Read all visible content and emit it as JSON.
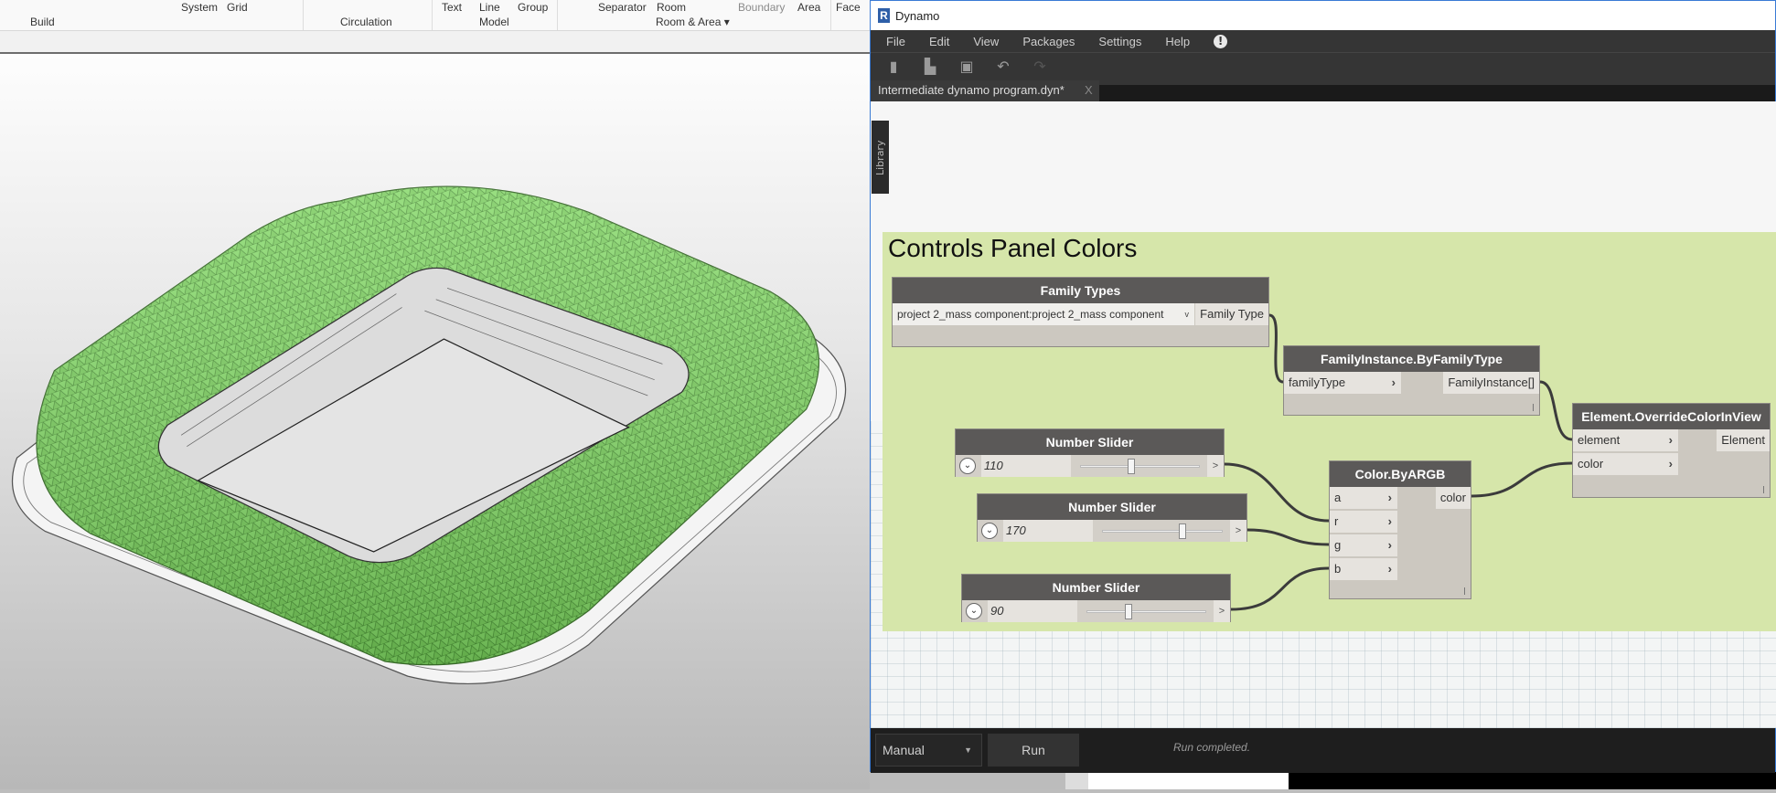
{
  "revit_ribbon": {
    "top_row": [
      "System",
      "Grid",
      "Text",
      "Line",
      "Group",
      "Separator",
      "Room",
      "Boundary",
      "Area",
      "Face"
    ],
    "panels": {
      "build": "Build",
      "circulation": "Circulation",
      "model": "Model",
      "room_area": "Room & Area ▾"
    }
  },
  "dynamo": {
    "window_title": "Dynamo",
    "menu": [
      "File",
      "Edit",
      "View",
      "Packages",
      "Settings",
      "Help"
    ],
    "toolbar_icons": [
      "new-file-icon",
      "open-file-icon",
      "save-icon",
      "undo-icon",
      "redo-icon"
    ],
    "tab": {
      "label": "Intermediate dynamo program.dyn*",
      "close": "X"
    },
    "library_label": "Library",
    "group_title": "Controls Panel Colors",
    "group_color": "#d6e6aa",
    "nodes": {
      "family_types": {
        "title": "Family Types",
        "value": "project 2_mass component:project 2_mass component",
        "output": "Family Type"
      },
      "family_instance": {
        "title": "FamilyInstance.ByFamilyType",
        "input": "familyType",
        "output": "FamilyInstance[]"
      },
      "override_color": {
        "title": "Element.OverrideColorInView",
        "inputs": [
          "element",
          "color"
        ],
        "output": "Element"
      },
      "color_argb": {
        "title": "Color.ByARGB",
        "inputs": [
          "a",
          "r",
          "g",
          "b"
        ],
        "output": "color"
      },
      "sliders": [
        {
          "title": "Number Slider",
          "value": "110",
          "position": 0.43
        },
        {
          "title": "Number Slider",
          "value": "170",
          "position": 0.67
        },
        {
          "title": "Number Slider",
          "value": "90",
          "position": 0.35
        }
      ]
    },
    "run_mode": "Manual",
    "run_button": "Run",
    "status": "Run completed."
  }
}
